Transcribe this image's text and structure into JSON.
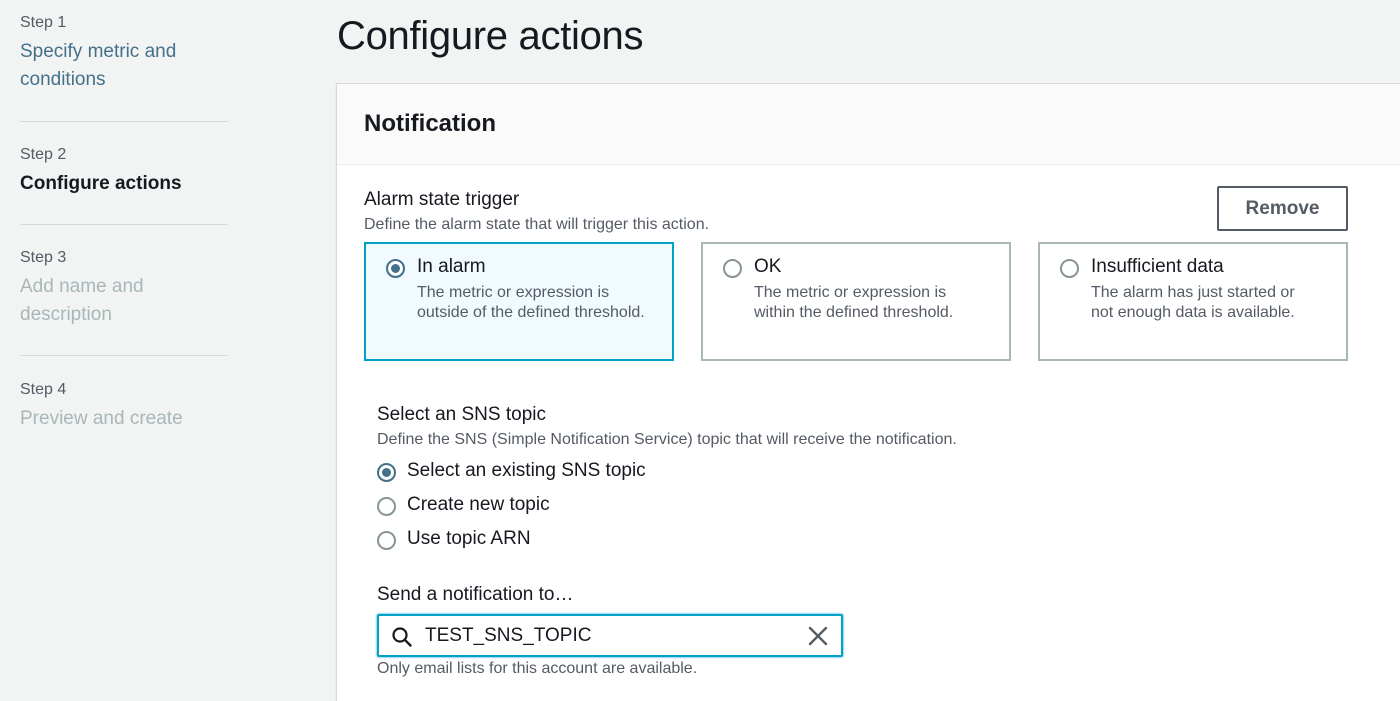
{
  "sidebar": {
    "steps": [
      {
        "number": "Step 1",
        "label": "Specify metric and conditions",
        "state": "link"
      },
      {
        "number": "Step 2",
        "label": "Configure actions",
        "state": "current"
      },
      {
        "number": "Step 3",
        "label": "Add name and description",
        "state": "disabled"
      },
      {
        "number": "Step 4",
        "label": "Preview and create",
        "state": "disabled"
      }
    ]
  },
  "page": {
    "title": "Configure actions"
  },
  "notification": {
    "title": "Notification",
    "remove_label": "Remove",
    "trigger": {
      "label": "Alarm state trigger",
      "description": "Define the alarm state that will trigger this action.",
      "options": [
        {
          "title": "In alarm",
          "description": "The metric or expression is outside of the defined threshold.",
          "selected": true
        },
        {
          "title": "OK",
          "description": "The metric or expression is within the defined threshold.",
          "selected": false
        },
        {
          "title": "Insufficient data",
          "description": "The alarm has just started or not enough data is available.",
          "selected": false
        }
      ]
    },
    "sns": {
      "label": "Select an SNS topic",
      "description": "Define the SNS (Simple Notification Service) topic that will receive the notification.",
      "options": [
        {
          "label": "Select an existing SNS topic",
          "selected": true
        },
        {
          "label": "Create new topic",
          "selected": false
        },
        {
          "label": "Use topic ARN",
          "selected": false
        }
      ]
    },
    "send_to": {
      "label": "Send a notification to…",
      "value": "TEST_SNS_TOPIC",
      "hint": "Only email lists for this account are available."
    }
  },
  "colors": {
    "accent": "#44718a",
    "focus_border": "#00a1c9",
    "selected_tile_bg": "#f1faff",
    "disabled_text": "#aab7b8"
  }
}
